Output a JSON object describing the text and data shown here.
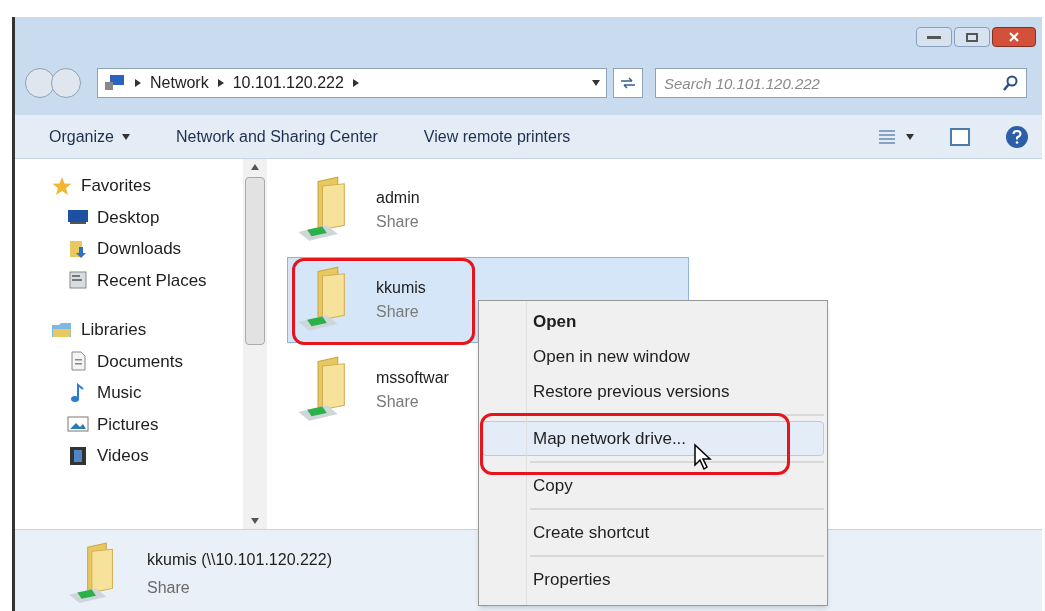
{
  "address_bar": {
    "crumbs": [
      "Network",
      "10.101.120.222"
    ]
  },
  "search": {
    "placeholder": "Search 10.101.120.222"
  },
  "toolbar": {
    "items": [
      {
        "label": "Organize",
        "kind": "menu"
      },
      {
        "label": "Network and Sharing Center",
        "kind": "plain"
      },
      {
        "label": "View remote printers",
        "kind": "plain"
      }
    ]
  },
  "sidebar": {
    "groups": [
      {
        "label": "Favorites",
        "kind": "favorites",
        "children": [
          {
            "label": "Desktop",
            "kind": "desktop"
          },
          {
            "label": "Downloads",
            "kind": "downloads"
          },
          {
            "label": "Recent Places",
            "kind": "recent"
          }
        ]
      },
      {
        "label": "Libraries",
        "kind": "libraries",
        "children": [
          {
            "label": "Documents",
            "kind": "documents"
          },
          {
            "label": "Music",
            "kind": "music"
          },
          {
            "label": "Pictures",
            "kind": "pictures"
          },
          {
            "label": "Videos",
            "kind": "videos"
          }
        ]
      }
    ]
  },
  "shares": [
    {
      "name": "admin",
      "type": "Share",
      "selected": false
    },
    {
      "name": "kkumis",
      "type": "Share",
      "selected": true
    },
    {
      "name": "mssoftwar",
      "type": "Share",
      "selected": false
    }
  ],
  "context_menu": {
    "items": [
      {
        "label": "Open",
        "default": true,
        "selected": false,
        "separator_before": false
      },
      {
        "label": "Open in new window",
        "default": false,
        "selected": false,
        "separator_before": false
      },
      {
        "label": "Restore previous versions",
        "default": false,
        "selected": false,
        "separator_before": false
      },
      {
        "label": "Map network drive...",
        "default": false,
        "selected": true,
        "separator_before": true
      },
      {
        "label": "Copy",
        "default": false,
        "selected": false,
        "separator_before": true
      },
      {
        "label": "Create shortcut",
        "default": false,
        "selected": false,
        "separator_before": true
      },
      {
        "label": "Properties",
        "default": false,
        "selected": false,
        "separator_before": true
      }
    ]
  },
  "details_pane": {
    "title": "kkumis (\\\\10.101.120.222)",
    "type": "Share"
  }
}
